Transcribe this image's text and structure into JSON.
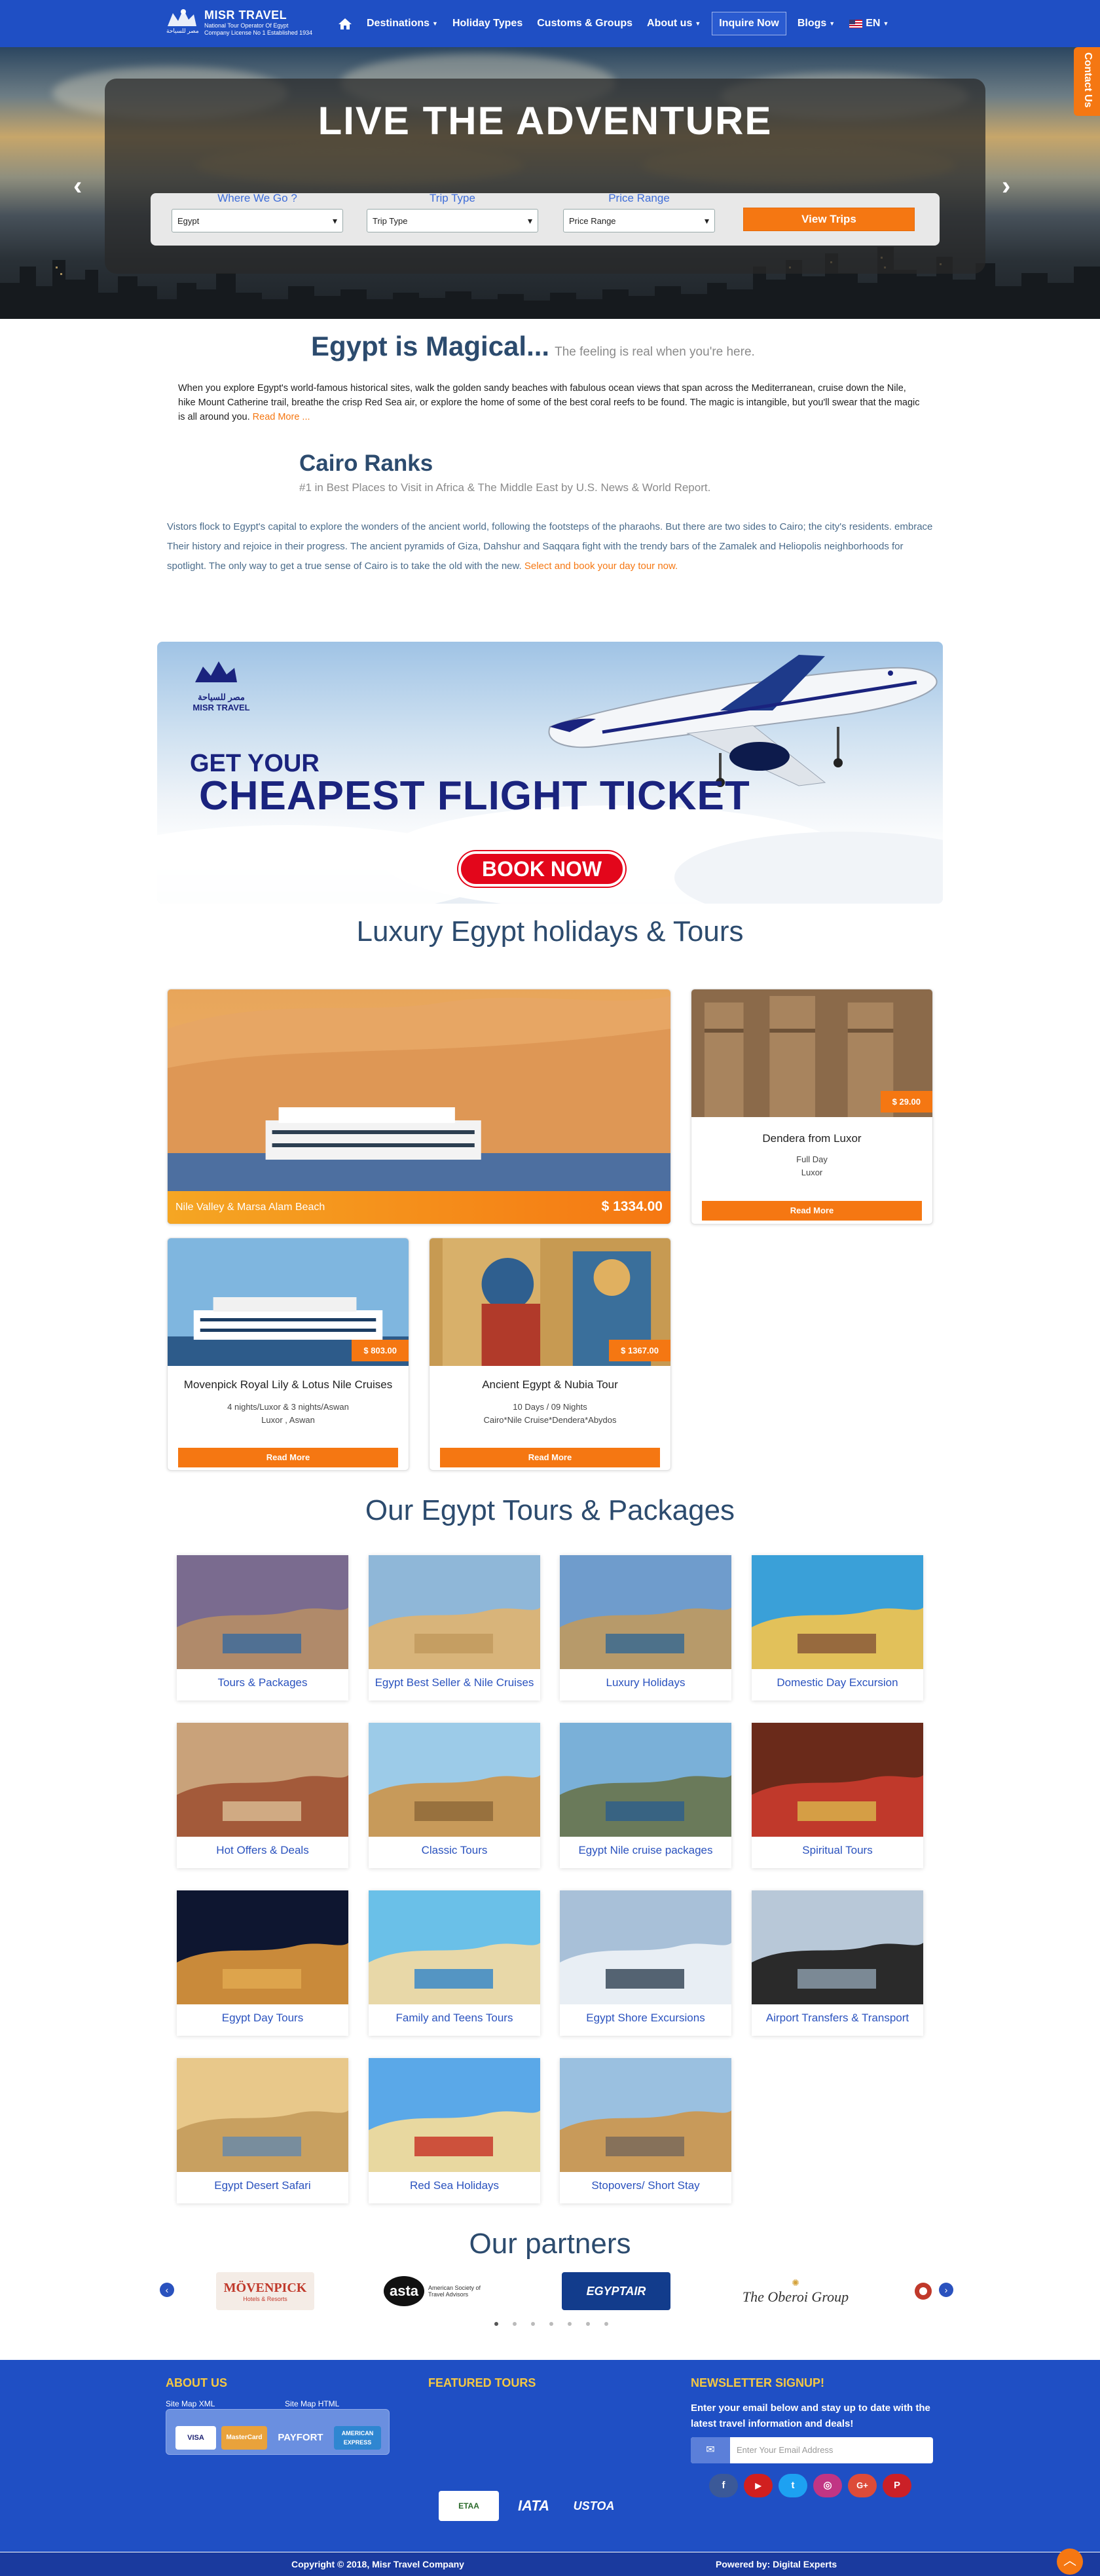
{
  "nav": {
    "brand": "MISR TRAVEL",
    "brand_sub1": "National Tour Operator Of Egypt",
    "brand_sub2": "Company License No 1 Established 1934",
    "brand_arabic": "مصر للسياحة",
    "items": [
      {
        "label": "Destinations",
        "dropdown": true
      },
      {
        "label": "Holiday Types",
        "dropdown": false
      },
      {
        "label": "Customs & Groups",
        "dropdown": false
      },
      {
        "label": "About us",
        "dropdown": true
      }
    ],
    "inquire": "Inquire Now",
    "blogs": "Blogs",
    "lang": "EN"
  },
  "hero": {
    "title": "LIVE THE ADVENTURE",
    "contact_tab": "Contact Us",
    "fields": [
      {
        "label": "Where We Go ?",
        "value": "Egypt"
      },
      {
        "label": "Trip Type",
        "value": "Trip Type"
      },
      {
        "label": "Price Range",
        "value": "Price Range"
      }
    ],
    "button": "View Trips"
  },
  "intro": {
    "title": "Egypt is Magical...",
    "subtitle": "The feeling is real when you're here.",
    "paragraph": "When you explore Egypt's world-famous historical sites, walk the golden sandy beaches with fabulous ocean views that span across the Mediterranean, cruise down the Nile, hike Mount Catherine trail, breathe the crisp Red Sea air, or explore the home of some of the best coral reefs to be found. The magic is intangible, but you'll swear that the magic is all around you.",
    "read_more": "Read More ..."
  },
  "cairo": {
    "title": "Cairo Ranks",
    "subtitle": "#1 in Best Places to Visit in Africa & The Middle East by U.S. News & World Report.",
    "paragraph": "Vistors flock to Egypt's capital to explore the wonders of the ancient world, following the footsteps of the pharaohs. But there are two sides to Cairo; the city's residents. embrace Their history and rejoice in their progress. The ancient pyramids of Giza, Dahshur and Saqqara fight with the trendy bars of the Zamalek and Heliopolis neighborhoods for spotlight. The only way to get a true sense of Cairo is to take the old with the new.",
    "link": "Select and book your day tour now."
  },
  "banner": {
    "logo_text": "MISR TRAVEL",
    "logo_arabic": "مصر للسياحة",
    "line1": "GET YOUR",
    "line2": "CHEAPEST FLIGHT TICKET",
    "button": "BOOK NOW"
  },
  "luxury": {
    "title": "Luxury Egypt holidays & Tours",
    "featured": {
      "name": "Nile Valley & Marsa Alam Beach",
      "price": "$ 1334.00"
    },
    "cards": [
      {
        "name": "Dendera from Luxor",
        "price": "$ 29.00",
        "d1": "Full Day",
        "d2": "Luxor",
        "button": "Read More"
      },
      {
        "name": "Movenpick Royal Lily & Lotus Nile Cruises",
        "price": "$ 803.00",
        "d1": "4 nights/Luxor & 3 nights/Aswan",
        "d2": "Luxor , Aswan",
        "button": "Read More"
      },
      {
        "name": "Ancient Egypt & Nubia Tour",
        "price": "$ 1367.00",
        "d1": "10 Days / 09 Nights",
        "d2": "Cairo*Nile Cruise*Dendera*Abydos",
        "button": "Read More"
      }
    ]
  },
  "packages": {
    "title": "Our Egypt Tours & Packages",
    "items": [
      "Tours & Packages",
      "Egypt Best Seller & Nile Cruises",
      "Luxury Holidays",
      "Domestic Day Excursion",
      "Hot Offers & Deals",
      "Classic Tours",
      "Egypt Nile cruise packages",
      "Spiritual Tours",
      "Egypt Day Tours",
      "Family and Teens Tours",
      "Egypt Shore Excursions",
      "Airport Transfers & Transport",
      "Egypt Desert Safari",
      "Red Sea Holidays",
      "Stopovers/ Short Stay"
    ]
  },
  "partners": {
    "title": "Our partners",
    "logos": [
      "MÖVENPICK",
      "Hotels & Resorts",
      "asta",
      "American Society of Travel Advisors",
      "EGYPTAIR",
      "The Oberoi Group"
    ]
  },
  "footer": {
    "about_title": "ABOUT US",
    "sitemap_xml": "Site Map XML",
    "sitemap_html": "Site Map HTML",
    "cards": [
      "VISA",
      "MasterCard",
      "PAYFORT",
      "AMERICAN EXPRESS"
    ],
    "featured_title": "FEATURED TOURS",
    "newsletter_title": "NEWSLETTER SIGNUP!",
    "newsletter_text": "Enter your email below and stay up to date with the latest travel information and deals!",
    "email_placeholder": "Enter Your Email Address",
    "social": [
      "f",
      "▶",
      "t",
      "◎",
      "G+",
      "P"
    ],
    "certs": [
      "ETAA",
      "IATA",
      "USTOA"
    ],
    "copyright": "Copyright © 2018, Misr Travel Company",
    "powered": "Powered by: Digital Experts"
  }
}
